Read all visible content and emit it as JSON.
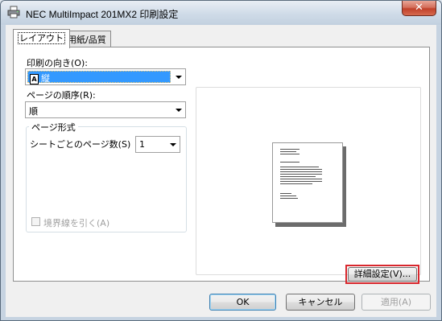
{
  "window": {
    "title": "NEC MultiImpact 201MX2 印刷設定",
    "close_glyph": "✕"
  },
  "tabs": [
    {
      "label": "レイアウト",
      "active": true
    },
    {
      "label": "用紙/品質",
      "active": false
    }
  ],
  "layout": {
    "orientation": {
      "label": "印刷の向き(O):",
      "value": "縦",
      "icon_glyph": "A"
    },
    "page_order": {
      "label": "ページの順序(R):",
      "value": "順"
    },
    "page_format": {
      "group_title": "ページ形式",
      "pages_per_sheet_label": "シートごとのページ数(S)",
      "pages_per_sheet_value": "1",
      "draw_borders_label": "境界線を引く(A)",
      "draw_borders_checked": false,
      "draw_borders_enabled": false
    },
    "advanced_button": "詳細設定(V)..."
  },
  "buttons": {
    "ok": "OK",
    "cancel": "キャンセル",
    "apply": "適用(A)"
  },
  "colors": {
    "selection": "#3399ff",
    "highlight": "#d8272d",
    "close": "#c1412a"
  }
}
